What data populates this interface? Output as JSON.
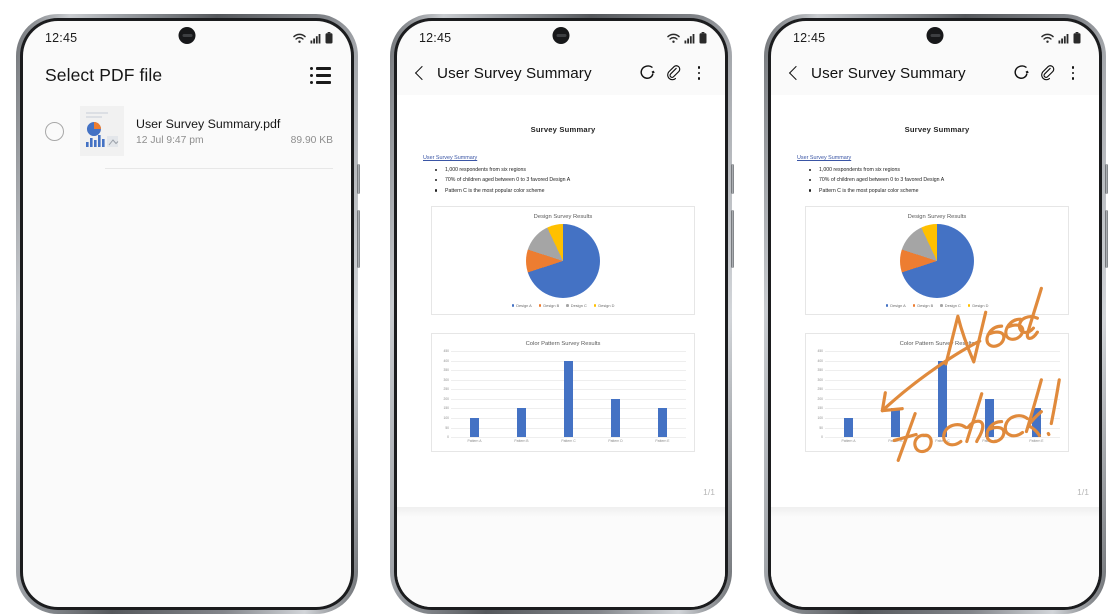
{
  "status_bar": {
    "time": "12:45",
    "icons": [
      "wifi-icon",
      "signal-icon",
      "battery-icon"
    ]
  },
  "screen_picker": {
    "title": "Select PDF file",
    "list_view_icon": "list-icon",
    "files": [
      {
        "name": "User Survey Summary.pdf",
        "date": "12 Jul 9:47 pm",
        "size": "89.90 KB",
        "selected": false
      }
    ]
  },
  "screen_viewer": {
    "back_icon": "chevron-left-icon",
    "title": "User Survey Summary",
    "pen_icon": "pen-annotate-icon",
    "attach_icon": "paperclip-icon",
    "menu_icon": "kebab-menu-icon",
    "page_indicator": "1/1"
  },
  "document": {
    "title": "Survey Summary",
    "section_heading": "User Survey Summary",
    "bullets": [
      "1,000 respondents from six regions",
      "70% of children aged between 0 to 3 favored Design A",
      "Pattern C is the most popular color scheme"
    ]
  },
  "annotation": {
    "line1": "Need",
    "line2": "to check!",
    "color": "#e08a3c"
  },
  "colors": {
    "accent_orange": "#e8703a",
    "bar_blue": "#4472c4",
    "pie_blue": "#4472c4",
    "pie_orange": "#ed7d31",
    "pie_gray": "#a5a5a5",
    "pie_yellow": "#ffc000"
  },
  "chart_data": [
    {
      "type": "pie",
      "title": "Design Survey Results",
      "categories": [
        "Design A",
        "Design B",
        "Design C",
        "Design D"
      ],
      "values": [
        70,
        10,
        13,
        7
      ],
      "colors": [
        "#4472c4",
        "#ed7d31",
        "#a5a5a5",
        "#ffc000"
      ],
      "legend_position": "bottom"
    },
    {
      "type": "bar",
      "title": "Color Pattern Survey Results",
      "categories": [
        "Pattern A",
        "Pattern B",
        "Pattern C",
        "Pattern D",
        "Pattern E"
      ],
      "values": [
        100,
        150,
        400,
        200,
        150
      ],
      "xlabel": "",
      "ylabel": "",
      "ylim": [
        0,
        450
      ],
      "yticks": [
        0,
        50,
        100,
        150,
        200,
        250,
        300,
        350,
        400,
        450
      ],
      "grid": true,
      "series_color": "#4472c4"
    }
  ]
}
